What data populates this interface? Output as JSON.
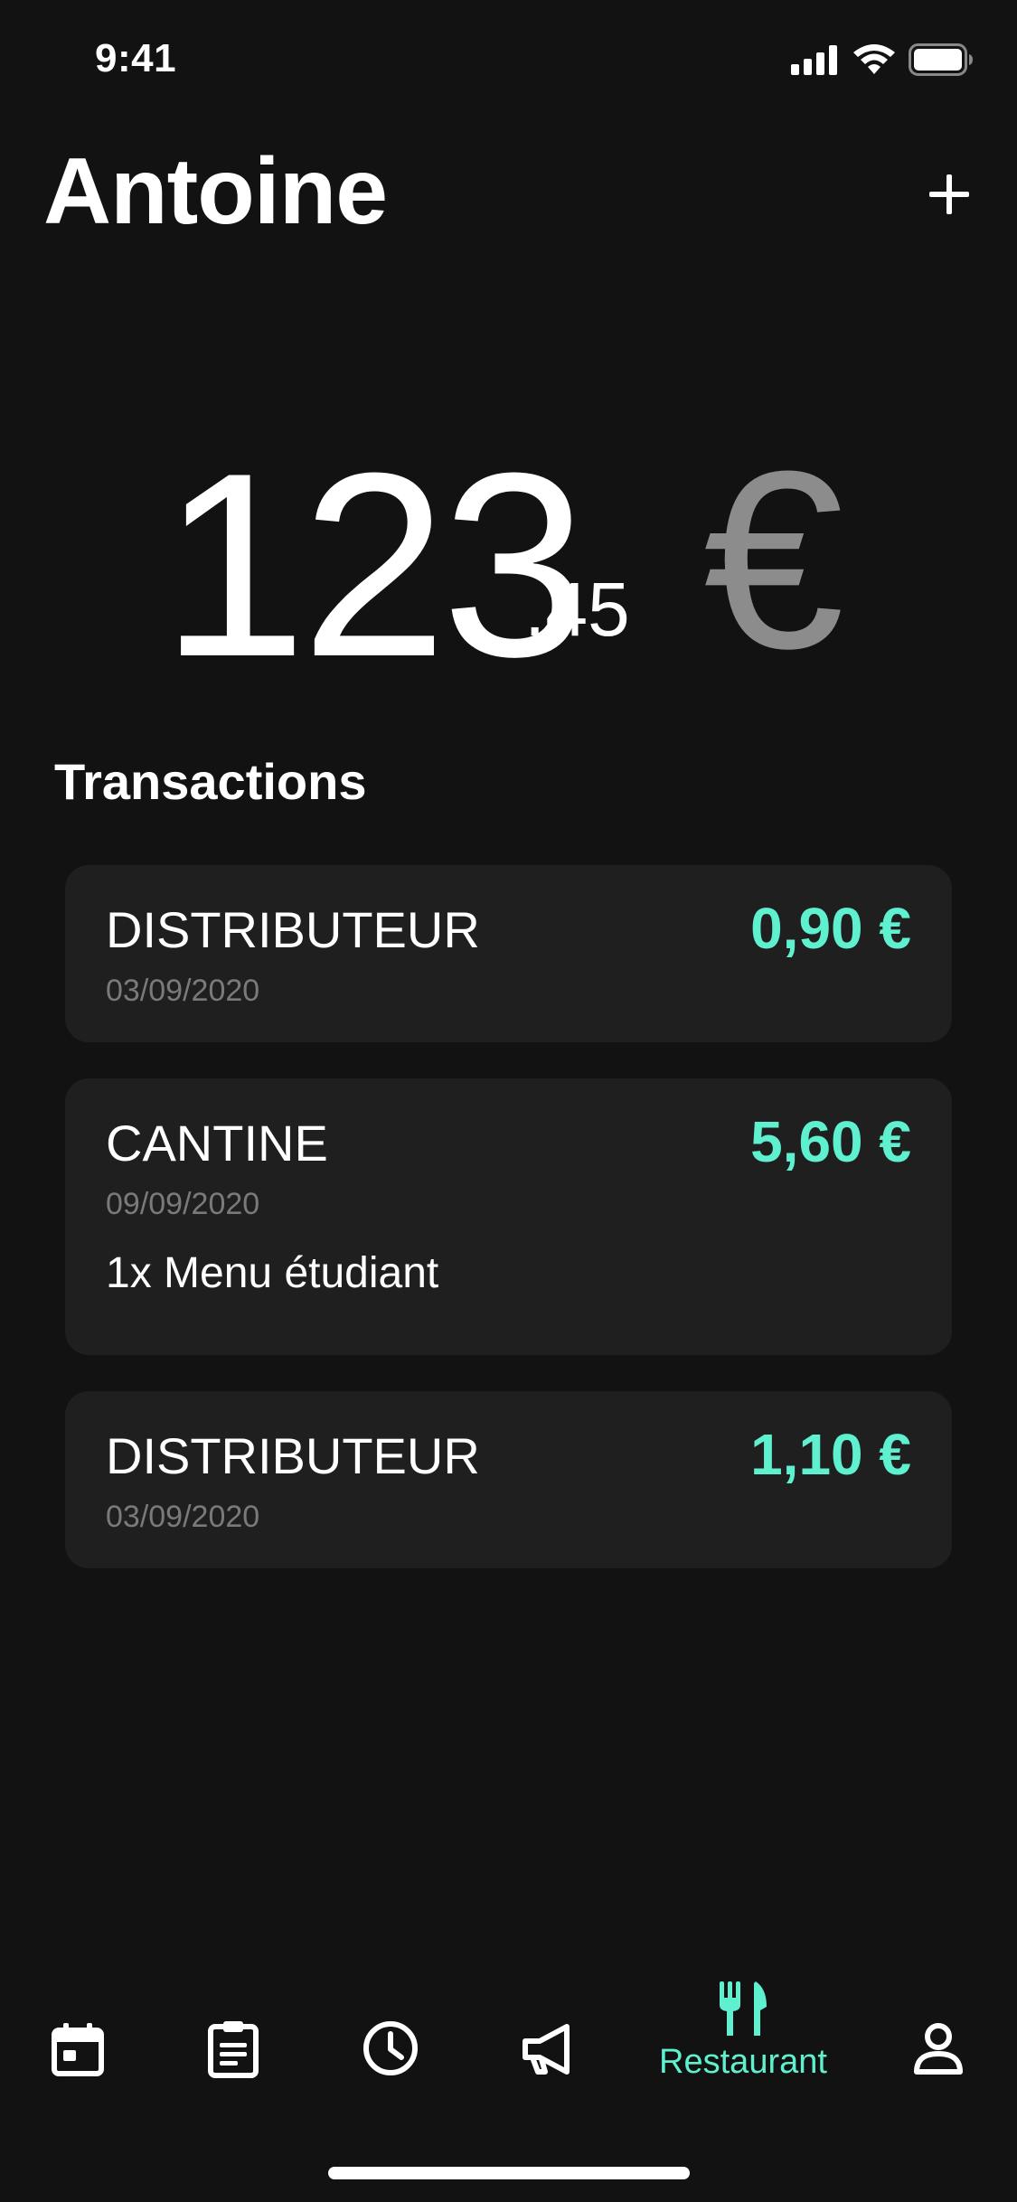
{
  "status_bar": {
    "time": "9:41"
  },
  "header": {
    "title": "Antoine",
    "add_icon": "plus-icon"
  },
  "balance": {
    "integer": "123",
    "decimal": ".45",
    "currency": "€"
  },
  "transactions": {
    "title": "Transactions",
    "items": [
      {
        "name": "DISTRIBUTEUR",
        "date": "03/09/2020",
        "amount": "0,90 €",
        "detail": ""
      },
      {
        "name": "CANTINE",
        "date": "09/09/2020",
        "amount": "5,60 €",
        "detail": "1x Menu étudiant"
      },
      {
        "name": "DISTRIBUTEUR",
        "date": "03/09/2020",
        "amount": "1,10 €",
        "detail": ""
      }
    ]
  },
  "bottom_nav": {
    "items": [
      {
        "icon": "calendar-icon",
        "label": ""
      },
      {
        "icon": "clipboard-icon",
        "label": ""
      },
      {
        "icon": "clock-icon",
        "label": ""
      },
      {
        "icon": "megaphone-icon",
        "label": ""
      },
      {
        "icon": "restaurant-icon",
        "label": "Restaurant",
        "active": true
      },
      {
        "icon": "profile-icon",
        "label": ""
      }
    ]
  },
  "colors": {
    "background": "#121212",
    "card": "#1f1f1f",
    "accent": "#5ef0cf",
    "muted": "#7a7a7a",
    "currency": "#8c8c8c"
  }
}
